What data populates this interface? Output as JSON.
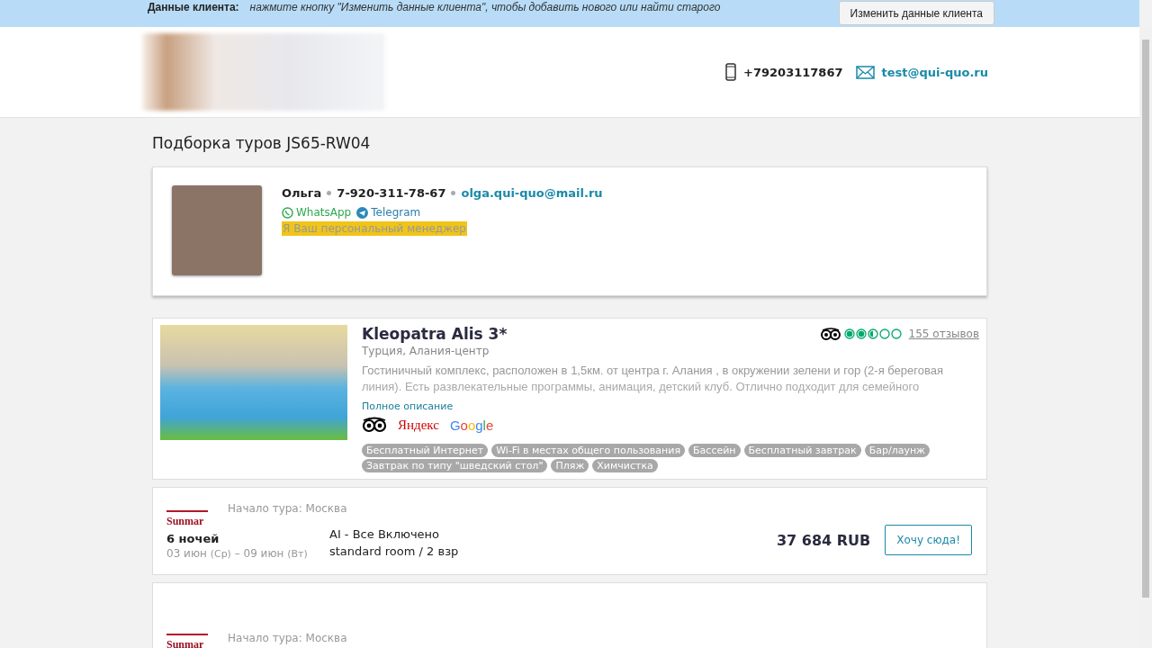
{
  "client_bar": {
    "label": "Данные клиента:",
    "hint": "нажмите кнопку \"Изменить данные клиента\", чтобы добавить нового или найти старого",
    "button": "Изменить данные клиента"
  },
  "header": {
    "phone": "+79203117867",
    "email": "test@qui-quo.ru"
  },
  "title": "Подборка туров JS65-RW04",
  "manager": {
    "name": "Ольга",
    "phone": "7-920-311-78-67",
    "email": "olga.qui-quo@mail.ru",
    "messengers": [
      {
        "kind": "whatsapp",
        "label": "WhatsApp"
      },
      {
        "kind": "telegram",
        "label": "Telegram"
      }
    ],
    "note": "Я Ваш персональный менеджер"
  },
  "hotel": {
    "name": "Kleopatra Alis 3*",
    "location": "Турция, Алания-центр",
    "stars": 2.5,
    "reviews": "155 отзывов",
    "description": [
      "Гостиничный комплекс, расположен в 1,5км. от центра г. Алания , в окружении зелени и гор (2-я береговая",
      "линия). Есть развлекательные программы, анимация, детский клуб. Отлично подходит для семейного"
    ],
    "more": "Полное описание",
    "sources": [
      {
        "kind": "owl"
      },
      {
        "kind": "yandex",
        "label": "Яндекс"
      },
      {
        "kind": "google",
        "label": "Google"
      }
    ],
    "tags": [
      "Бесплатный Интернет",
      "Wi-Fi в местах общего пользования",
      "Бассейн",
      "Бесплатный завтрак",
      "Бар/лаунж",
      "Завтрак по типу \"шведский стол\"",
      "Пляж",
      "Химчистка"
    ]
  },
  "offers": [
    {
      "operator": "Sunmar",
      "start": "Начало тура: Москва",
      "nights": "6 ночей",
      "dates": "03 июн",
      "dates_day1": "(Ср)",
      "dates_sep": "–",
      "dates2": "09 июн",
      "dates_day2": "(Вт)",
      "meal": "AI - Все Включено",
      "room": "standard room / 2 взр",
      "price": "37 684 RUB",
      "button": "Хочу сюда!"
    },
    {
      "operator": "Sunmar",
      "start": "Начало тура: Москва"
    }
  ]
}
